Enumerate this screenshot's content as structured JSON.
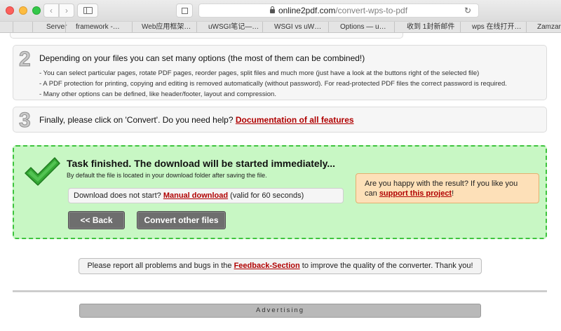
{
  "browser": {
    "url_host": "online2pdf.com",
    "url_path": "/convert-wps-to-pdf",
    "bookmarks": [
      "Server",
      "framework -…",
      "Web应用框架…",
      "uWSGI笔记—…",
      "WSGI vs uW…",
      "Options — u…",
      "收到 1封新邮件",
      "wps 在线打开…",
      "Zamzar"
    ]
  },
  "step2": {
    "number": "2",
    "title": "Depending on your files you can set many options (the most of them can be combined!)",
    "items": [
      "- You can select particular pages, rotate PDF pages, reorder pages, split files and much more (just have a look at the buttons right of the selected file)",
      "- A PDF protection for printing, copying and editing is removed automatically (without password). For read-protected PDF files the correct password is required.",
      "- Many other options can be defined, like header/footer, layout and compression."
    ]
  },
  "step3": {
    "number": "3",
    "text": "Finally, please click on 'Convert'. Do you need help?",
    "link": "Documentation of all features"
  },
  "task": {
    "title": "Task finished. The download will be started immediately...",
    "subtitle": "By default the file is located in your download folder after saving the file.",
    "download_prefix": "Download does not start?",
    "download_link": "Manual download",
    "download_suffix": "(valid for 60 seconds)",
    "back_label": "<< Back",
    "convert_other_label": "Convert other files",
    "happy_line1": "Are you happy with the result? If you like you",
    "happy_can": "can",
    "happy_link": "support this project",
    "happy_end": "!"
  },
  "report": {
    "prefix": "Please report all problems and bugs in the",
    "link": "Feedback-Section",
    "suffix": "to improve the quality of the converter. Thank you!"
  },
  "advertising": "Advertising",
  "colors": {
    "link_red": "#b00000",
    "task_bg": "#c8f7c4",
    "task_border": "#3ec43e",
    "happy_bg": "#fde0b8"
  }
}
